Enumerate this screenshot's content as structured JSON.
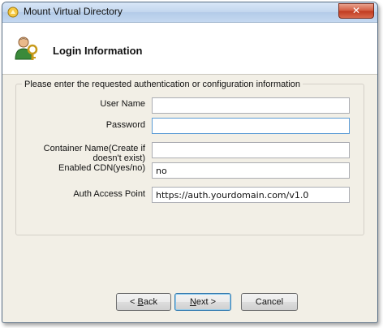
{
  "window": {
    "title": "Mount Virtual Directory",
    "close_label": "✕"
  },
  "header": {
    "title": "Login Information"
  },
  "form": {
    "caption": "Please enter the requested authentication or configuration information",
    "fields": [
      {
        "label": "User Name",
        "value": ""
      },
      {
        "label": "Password",
        "value": ""
      },
      {
        "label_line1": "Container Name(Create if",
        "label_line2": "doesn't exist)",
        "value": ""
      },
      {
        "label": "Enabled CDN(yes/no)",
        "value": "no"
      },
      {
        "label": "Auth Access Point",
        "value": "https://auth.yourdomain.com/v1.0"
      }
    ]
  },
  "buttons": {
    "back_prefix": "< ",
    "back_accel": "B",
    "back_rest": "ack",
    "next_accel": "N",
    "next_rest": "ext >",
    "cancel": "Cancel"
  },
  "colors": {
    "accent": "#3c7fb1",
    "close_red": "#c0391f",
    "window_bg": "#f2efe6"
  }
}
